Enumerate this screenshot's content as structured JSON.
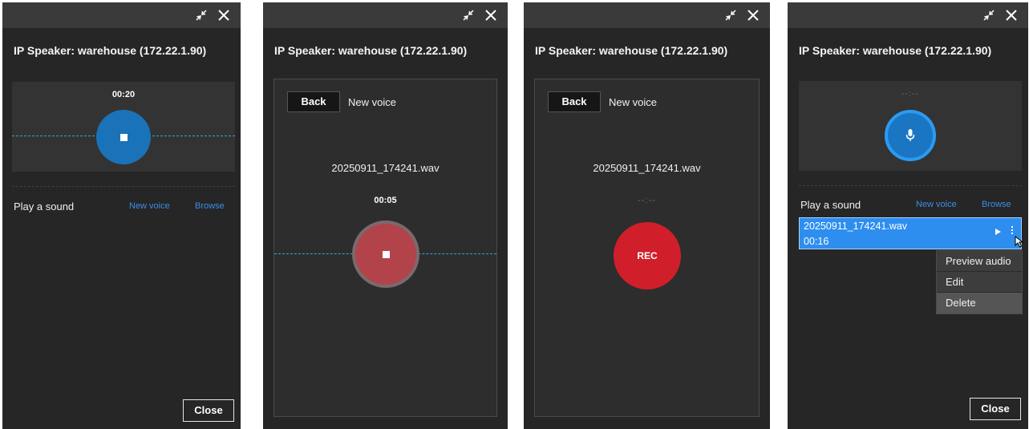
{
  "device_title": "IP Speaker:  warehouse (172.22.1.90)",
  "panels": {
    "recording": {
      "timer": "00:20",
      "play_label": "Play a sound",
      "new_voice_link": "New voice",
      "browse_link": "Browse",
      "close_label": "Close"
    },
    "new_voice_recording": {
      "back_label": "Back",
      "title": "New voice",
      "file_name": "20250911_174241.wav",
      "timer": "00:05"
    },
    "new_voice_ready": {
      "back_label": "Back",
      "title": "New voice",
      "file_name": "20250911_174241.wav",
      "timer": "--:--",
      "rec_label": "REC"
    },
    "file_list": {
      "timer": "--:--",
      "play_label": "Play a sound",
      "new_voice_link": "New voice",
      "browse_link": "Browse",
      "file": {
        "name": "20250911_174241.wav",
        "duration": "00:16"
      },
      "menu": [
        "Preview audio",
        "Edit",
        "Delete"
      ],
      "close_label": "Close"
    }
  },
  "icons": [
    "collapse-icon",
    "close-icon",
    "stop-icon",
    "mic-icon",
    "play-icon",
    "more-vertical-icon",
    "cursor-icon"
  ],
  "colors": {
    "accent_blue": "#2e8ef0",
    "record_red": "#d01f2a",
    "panel_bg": "#262626",
    "link": "#3a8ee6"
  }
}
